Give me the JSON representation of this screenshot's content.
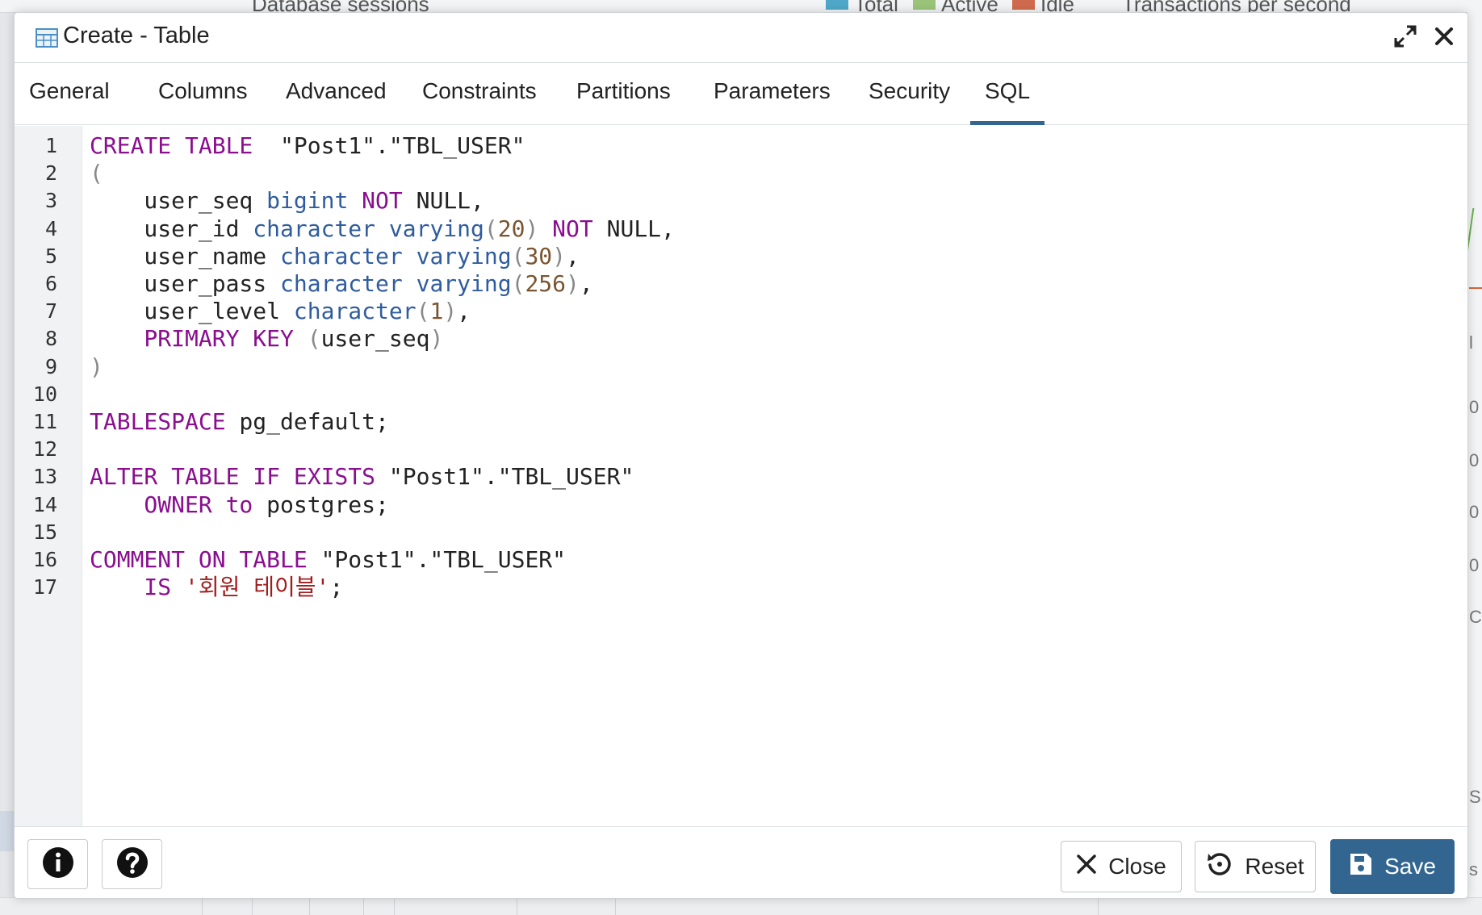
{
  "background": {
    "panel_left_title": "Database sessions",
    "legend": [
      {
        "label": "Total",
        "color": "#4fa8c9"
      },
      {
        "label": "Active",
        "color": "#9bc47a"
      },
      {
        "label": "Idle",
        "color": "#d06a4e"
      }
    ],
    "panel_right_title": "Transactions per second",
    "edge_ticks": [
      "l",
      "0",
      "0",
      "0",
      "0",
      "C",
      "S",
      "s"
    ]
  },
  "dialog": {
    "title": "Create - Table",
    "title_icon": "table-icon",
    "maximize_icon": "expand-icon",
    "close_icon": "close-icon"
  },
  "tabs": [
    {
      "label": "General",
      "active": false
    },
    {
      "label": "Columns",
      "active": false
    },
    {
      "label": "Advanced",
      "active": false
    },
    {
      "label": "Constraints",
      "active": false
    },
    {
      "label": "Partitions",
      "active": false
    },
    {
      "label": "Parameters",
      "active": false
    },
    {
      "label": "Security",
      "active": false
    },
    {
      "label": "SQL",
      "active": true
    }
  ],
  "sql": {
    "line_numbers": [
      "1",
      "2",
      "3",
      "4",
      "5",
      "6",
      "7",
      "8",
      "9",
      "10",
      "11",
      "12",
      "13",
      "14",
      "15",
      "16",
      "17"
    ],
    "lines": [
      [
        [
          "kw",
          "CREATE TABLE"
        ],
        [
          "",
          "  \"Post1\".\"TBL_USER\""
        ]
      ],
      [
        [
          "pu",
          "("
        ]
      ],
      [
        [
          "",
          "    user_seq "
        ],
        [
          "ty",
          "bigint"
        ],
        [
          "",
          ""
        ],
        [
          "kw",
          " NOT"
        ],
        [
          "",
          " NULL,"
        ]
      ],
      [
        [
          "",
          "    user_id "
        ],
        [
          "ty",
          "character varying"
        ],
        [
          "pu",
          "("
        ],
        [
          "nm",
          "20"
        ],
        [
          "pu",
          ")"
        ],
        [
          "kw",
          " NOT"
        ],
        [
          "",
          " NULL,"
        ]
      ],
      [
        [
          "",
          "    user_name "
        ],
        [
          "ty",
          "character varying"
        ],
        [
          "pu",
          "("
        ],
        [
          "nm",
          "30"
        ],
        [
          "pu",
          ")"
        ],
        [
          "",
          ","
        ]
      ],
      [
        [
          "",
          "    user_pass "
        ],
        [
          "ty",
          "character varying"
        ],
        [
          "pu",
          "("
        ],
        [
          "nm",
          "256"
        ],
        [
          "pu",
          ")"
        ],
        [
          "",
          ","
        ]
      ],
      [
        [
          "",
          "    user_level "
        ],
        [
          "ty",
          "character"
        ],
        [
          "pu",
          "("
        ],
        [
          "nm",
          "1"
        ],
        [
          "pu",
          ")"
        ],
        [
          "",
          ","
        ]
      ],
      [
        [
          "kw",
          "    PRIMARY KEY "
        ],
        [
          "pu",
          "("
        ],
        [
          "",
          "user_seq"
        ],
        [
          "pu",
          ")"
        ]
      ],
      [
        [
          "pu",
          ")"
        ]
      ],
      [],
      [
        [
          "kw",
          "TABLESPACE"
        ],
        [
          "",
          " pg_default;"
        ]
      ],
      [],
      [
        [
          "kw",
          "ALTER TABLE IF EXISTS"
        ],
        [
          "",
          " \"Post1\".\"TBL_USER\""
        ]
      ],
      [
        [
          "kw",
          "    OWNER to"
        ],
        [
          "",
          " postgres;"
        ]
      ],
      [],
      [
        [
          "kw",
          "COMMENT ON TABLE"
        ],
        [
          "",
          " \"Post1\".\"TBL_USER\""
        ]
      ],
      [
        [
          "kw",
          "    IS "
        ],
        [
          "st",
          "'회원 테이블'"
        ],
        [
          "",
          ";"
        ]
      ]
    ]
  },
  "footer": {
    "info_icon": "info-icon",
    "help_icon": "help-icon",
    "close_label": "Close",
    "reset_label": "Reset",
    "save_label": "Save",
    "save_color": "#326690"
  }
}
